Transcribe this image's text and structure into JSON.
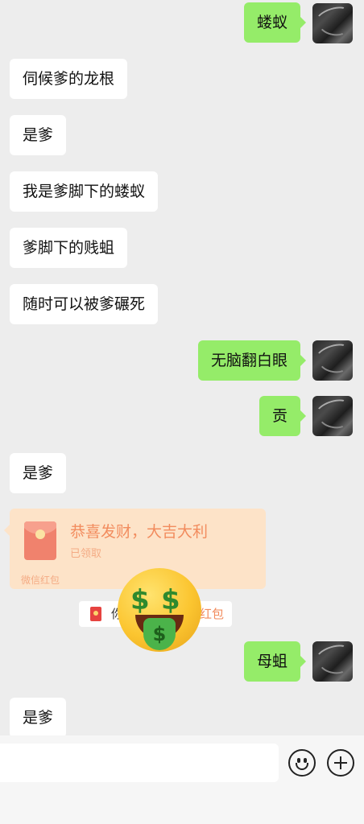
{
  "messages": [
    {
      "side": "right",
      "text": "蝼蚁"
    },
    {
      "side": "left",
      "text": "伺候爹的龙根"
    },
    {
      "side": "left",
      "text": "是爹"
    },
    {
      "side": "left",
      "text": "我是爹脚下的蝼蚁"
    },
    {
      "side": "left",
      "text": "爹脚下的贱蛆"
    },
    {
      "side": "left",
      "text": "随时可以被爹碾死"
    },
    {
      "side": "right",
      "text": "无脑翻白眼"
    },
    {
      "side": "right",
      "text": "贡"
    },
    {
      "side": "left",
      "text": "是爹"
    },
    {
      "side": "right",
      "text": "母蛆"
    },
    {
      "side": "left",
      "text": "是爹"
    }
  ],
  "red_packet": {
    "title": "恭喜发财，大吉大利",
    "status": "已领取",
    "footer": "微信红包"
  },
  "notice": {
    "prefix": "你",
    "suffix": "红包"
  },
  "emoji": {
    "name": "money-mouth-face-icon",
    "eye": "$",
    "tongue": "$"
  },
  "input_bar": {
    "emoji_button": "emoji-icon",
    "plus_button": "plus-icon"
  },
  "colors": {
    "background": "#ededed",
    "own_bubble": "#95ec69",
    "other_bubble": "#ffffff",
    "red_packet_bg": "#fde3c8",
    "red_packet_text": "#f28c5e"
  }
}
